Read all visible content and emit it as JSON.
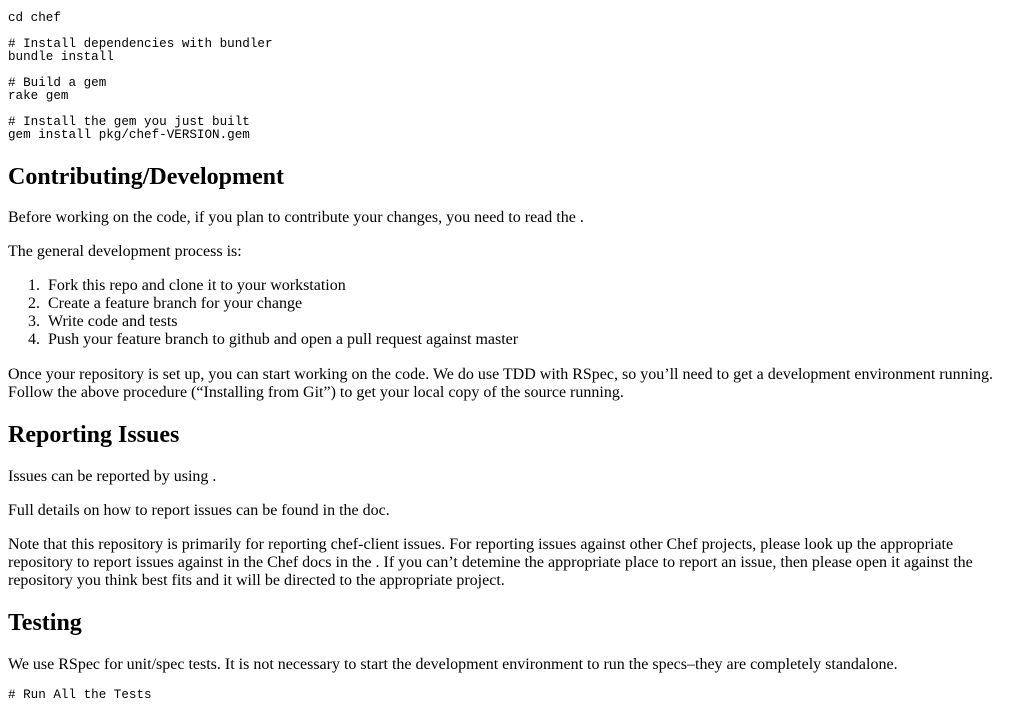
{
  "code_block_top": {
    "lines": [
      "cd chef",
      "",
      "# Install dependencies with bundler",
      "bundle install",
      "",
      "# Build a gem",
      "rake gem",
      "",
      "# Install the gem you just built",
      "gem install pkg/chef-VERSION.gem"
    ]
  },
  "contributing": {
    "heading": "Contributing/Development",
    "intro": "Before working on the code, if you plan to contribute your changes, you need to read the .",
    "process_label": "The general development process is:",
    "steps": [
      {
        "num": "1.",
        "text": "Fork this repo and clone it to your workstation"
      },
      {
        "num": "2.",
        "text": "Create a feature branch for your change"
      },
      {
        "num": "3.",
        "text": "Write code and tests"
      },
      {
        "num": "4.",
        "text": "Push your feature branch to github and open a pull request against master"
      }
    ],
    "setup_line1": "Once your repository is set up, you can start working on the code. We do use TDD with RSpec, so you’ll need to get a development environment running.",
    "setup_line2": "Follow the above procedure (“Installing from Git”) to get your local copy of the source running."
  },
  "reporting": {
    "heading": "Reporting Issues",
    "line1": "Issues can be reported by using .",
    "line2": "Full details on how to report issues can be found in the doc.",
    "note_line1": "Note that this repository is primarily for reporting chef-client issues. For reporting issues against other Chef projects, please look up the appropriate",
    "note_line2": "repository to report issues against in the Chef docs in the . If you can’t detemine the appropriate place to report an issue, then please open it against the",
    "note_line3": "repository you think best fits and it will be directed to the appropriate project."
  },
  "testing": {
    "heading": "Testing",
    "line1": "We use RSpec for unit/spec tests. It is not necessary to start the development environment to run the specs–they are completely standalone.",
    "code_line": "# Run All the Tests"
  }
}
